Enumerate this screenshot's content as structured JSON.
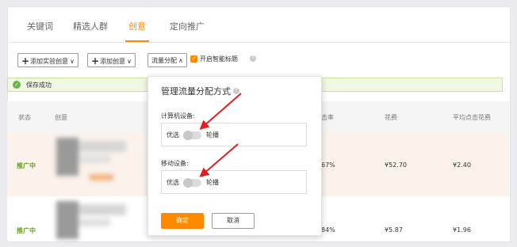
{
  "tabs": [
    {
      "label": "关键词"
    },
    {
      "label": "精选人群"
    },
    {
      "label": "创意"
    },
    {
      "label": "定向推广"
    }
  ],
  "active_tab": "创意",
  "toolbar": {
    "add_experiment_label": "添加实验创意",
    "add_creative_label": "添加创意",
    "traffic_allocation_label": "流量分配",
    "smart_title_label": "开启智能标题",
    "smart_title_checked": true
  },
  "success_message": "保存成功",
  "table": {
    "headers": [
      "状态",
      "创意",
      "击率",
      "花费",
      "平均点击花费"
    ],
    "rows": [
      {
        "status": "推广中",
        "ctr": "67%",
        "cost": "¥52.70",
        "cpc": "¥2.40"
      },
      {
        "status": "推广中",
        "ctr": "84%",
        "cost": "¥5.87",
        "cpc": "¥1.96"
      }
    ]
  },
  "popup": {
    "title": "管理流量分配方式",
    "computer_label": "计算机设备:",
    "mobile_label": "移动设备:",
    "option_left": "优选",
    "option_right": "轮播",
    "confirm_label": "确定",
    "cancel_label": "取消"
  },
  "colors": {
    "accent": "#ff8a00",
    "status_green": "#6a9a2c",
    "arrow_red": "#e02020"
  }
}
